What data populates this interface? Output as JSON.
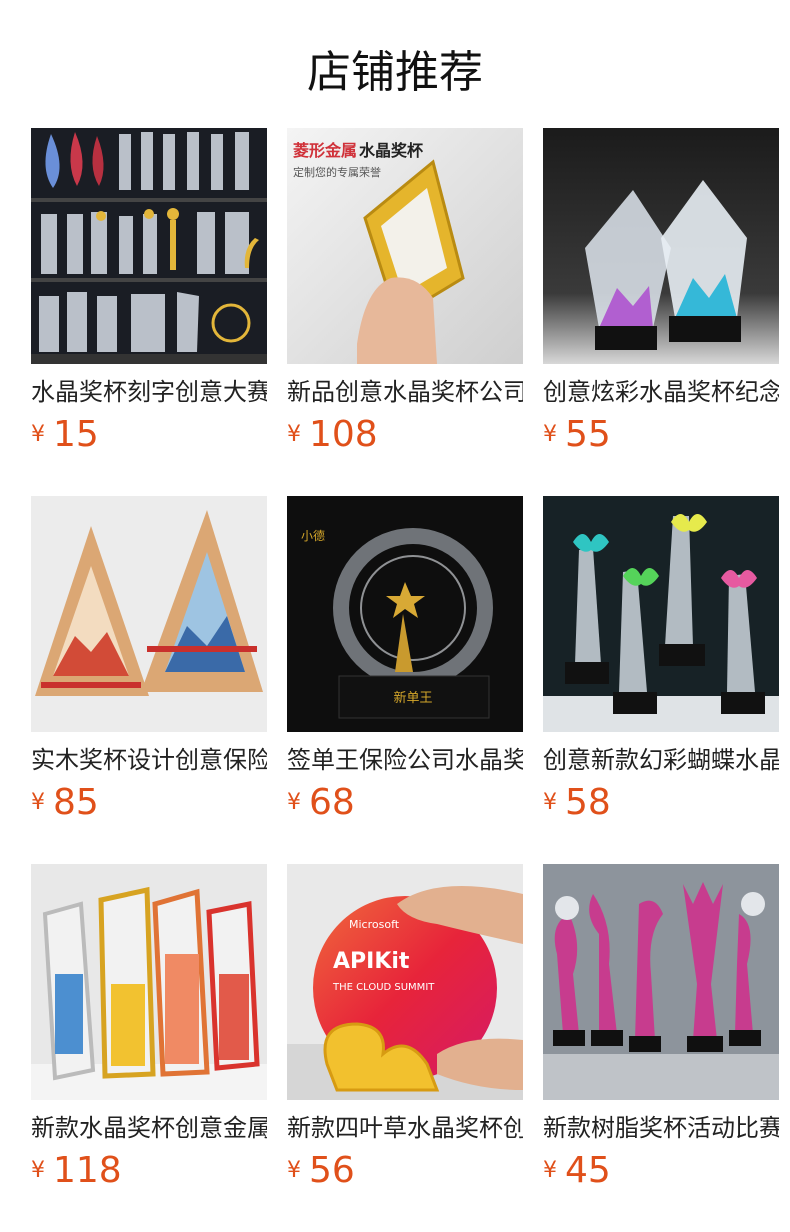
{
  "header": {
    "title": "店铺推荐"
  },
  "products": [
    {
      "name": "水晶奖杯刻字创意大赛",
      "currency": "¥",
      "price": "15"
    },
    {
      "name": "新品创意水晶奖杯公司",
      "currency": "¥",
      "price": "108"
    },
    {
      "name": "创意炫彩水晶奖杯纪念",
      "currency": "¥",
      "price": "55"
    },
    {
      "name": "实木奖杯设计创意保险",
      "currency": "¥",
      "price": "85"
    },
    {
      "name": "签单王保险公司水晶奖",
      "currency": "¥",
      "price": "68"
    },
    {
      "name": "创意新款幻彩蝴蝶水晶",
      "currency": "¥",
      "price": "58"
    },
    {
      "name": "新款水晶奖杯创意金属",
      "currency": "¥",
      "price": "118"
    },
    {
      "name": "新款四叶草水晶奖杯创",
      "currency": "¥",
      "price": "56"
    },
    {
      "name": "新款树脂奖杯活动比赛",
      "currency": "¥",
      "price": "45"
    }
  ],
  "image_text": {
    "p2_heading_a": "菱形金属",
    "p2_heading_b": "水晶奖杯",
    "p2_sub": "定制您的专属荣誉",
    "p5_brand": "小德",
    "p5_plaque": "新单王",
    "p8_brand": "Microsoft",
    "p8_title": "APIKit",
    "p8_sub": "THE CLOUD SUMMIT"
  },
  "colors": {
    "price": "#e0501a",
    "text": "#222222"
  }
}
